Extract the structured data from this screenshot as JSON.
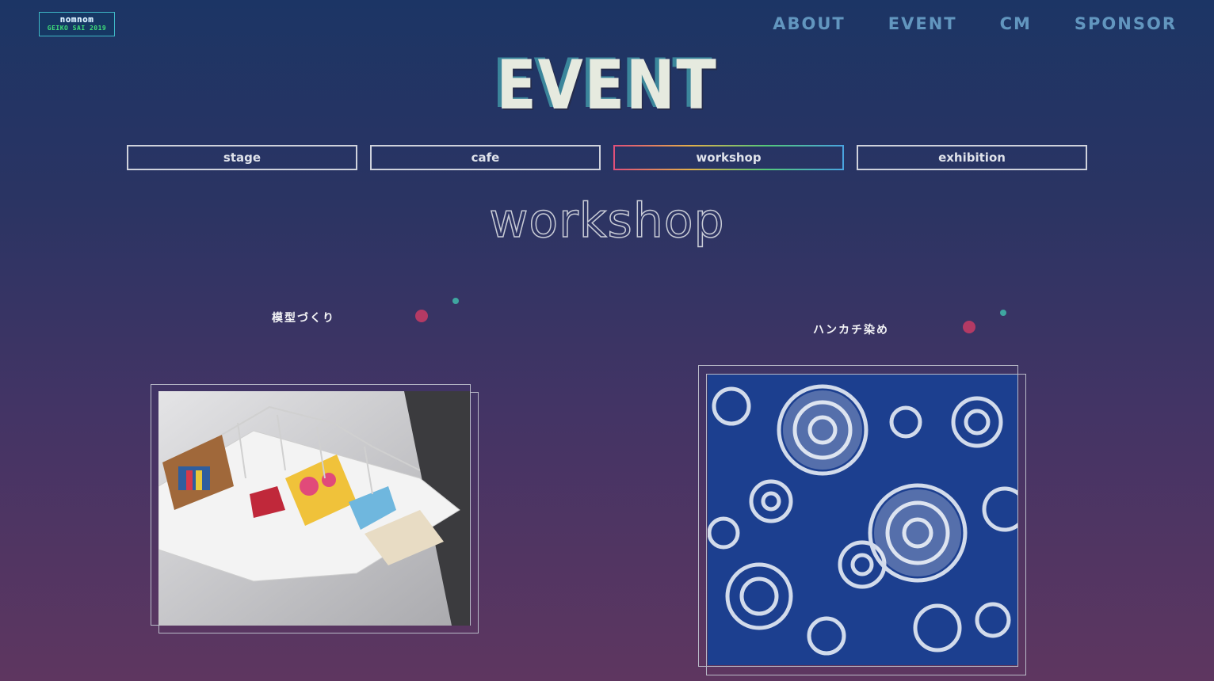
{
  "header": {
    "logo_line1": "nomnom",
    "logo_line2": "GEIKO SAI 2019",
    "nav": [
      "ABOUT",
      "EVENT",
      "CM",
      "SPONSOR"
    ]
  },
  "page_title": "EVENT",
  "tabs": [
    {
      "label": "stage",
      "active": false
    },
    {
      "label": "cafe",
      "active": false
    },
    {
      "label": "workshop",
      "active": true
    },
    {
      "label": "exhibition",
      "active": false
    }
  ],
  "section_title": "workshop",
  "workshops": [
    {
      "title": "模型づくり",
      "image": "architectural-model-photo"
    },
    {
      "title": "ハンカチ染め",
      "image": "indigo-tie-dye-photo"
    }
  ],
  "colors": {
    "accent_pink": "#b43a64",
    "accent_teal": "#3fa6a0",
    "nav_blue": "#6fa8cf"
  }
}
